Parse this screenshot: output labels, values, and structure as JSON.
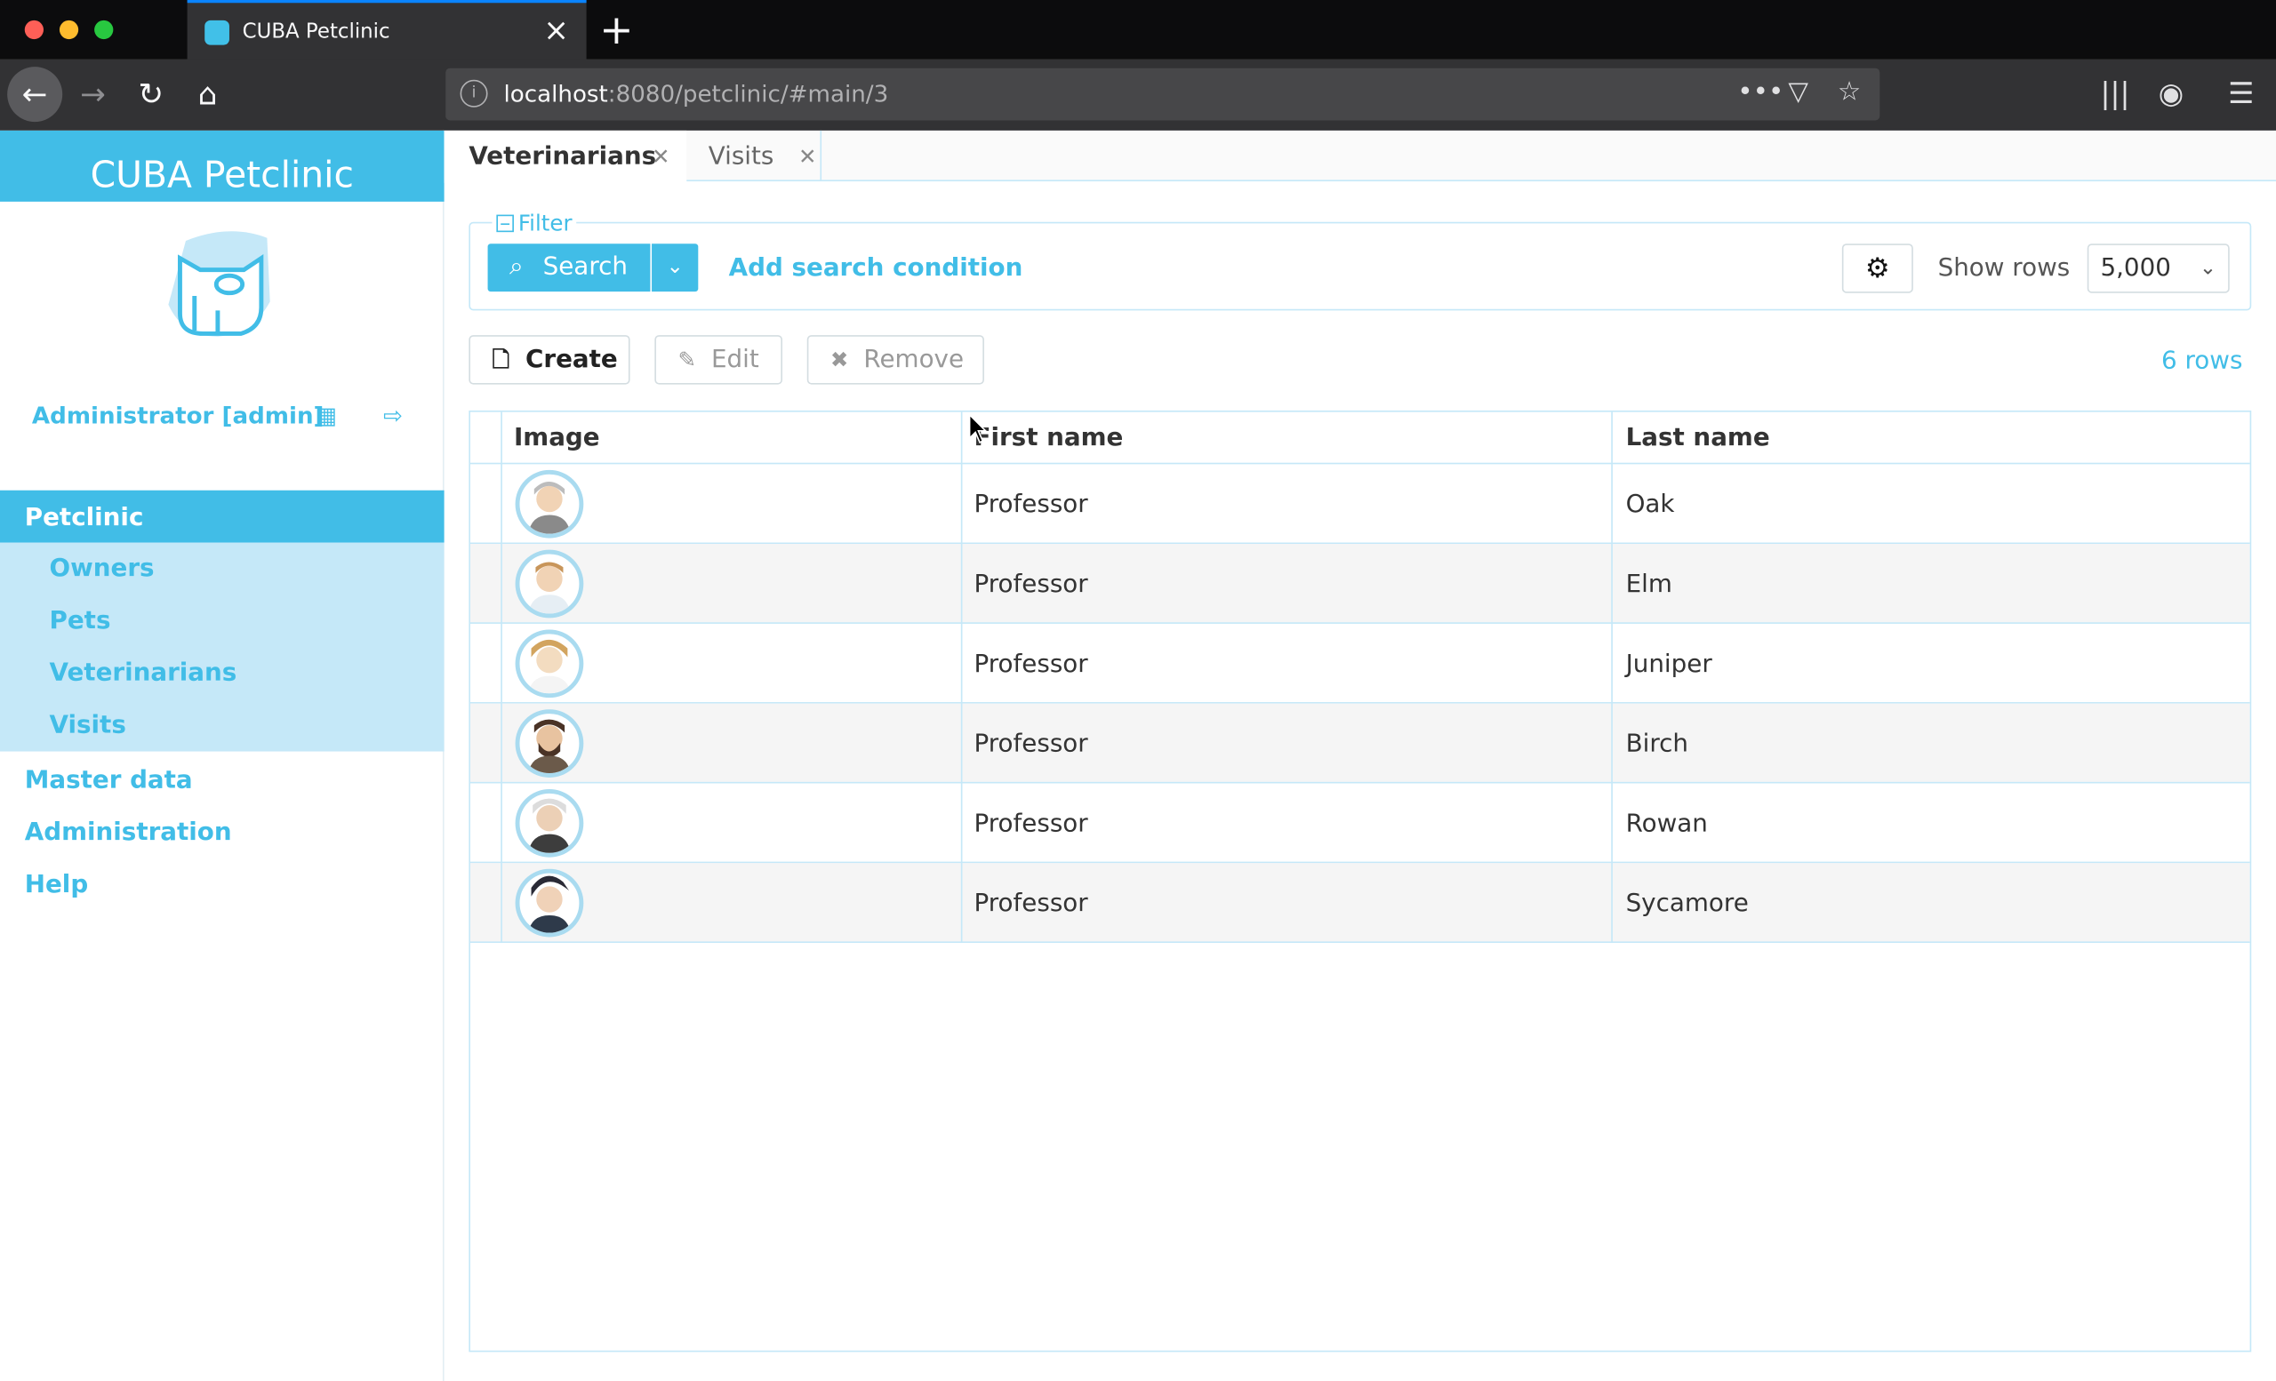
{
  "browser": {
    "tab_title": "CUBA Petclinic",
    "url_host": "localhost",
    "url_rest": ":8080/petclinic/#main/3"
  },
  "app": {
    "title": "CUBA Petclinic",
    "user": "Administrator [admin]"
  },
  "menu": {
    "root": "Petclinic",
    "sub": [
      "Owners",
      "Pets",
      "Veterinarians",
      "Visits"
    ],
    "items": [
      "Master data",
      "Administration",
      "Help"
    ]
  },
  "tabs": [
    "Veterinarians",
    "Visits"
  ],
  "filter": {
    "legend": "Filter",
    "search_label": "Search",
    "add_condition": "Add search condition",
    "show_rows_label": "Show rows",
    "rows_value": "5,000"
  },
  "actions": {
    "create": "Create",
    "edit": "Edit",
    "remove": "Remove",
    "rows_count": "6 rows"
  },
  "table": {
    "columns": [
      "Image",
      "First name",
      "Last name"
    ],
    "rows": [
      {
        "first": "Professor",
        "last": "Oak"
      },
      {
        "first": "Professor",
        "last": "Elm"
      },
      {
        "first": "Professor",
        "last": "Juniper"
      },
      {
        "first": "Professor",
        "last": "Birch"
      },
      {
        "first": "Professor",
        "last": "Rowan"
      },
      {
        "first": "Professor",
        "last": "Sycamore"
      }
    ]
  },
  "colors": {
    "accent": "#41bde7",
    "accent_light": "#c5e8f8",
    "chrome_dark": "#0c0c0d",
    "chrome_bar": "#323234"
  }
}
